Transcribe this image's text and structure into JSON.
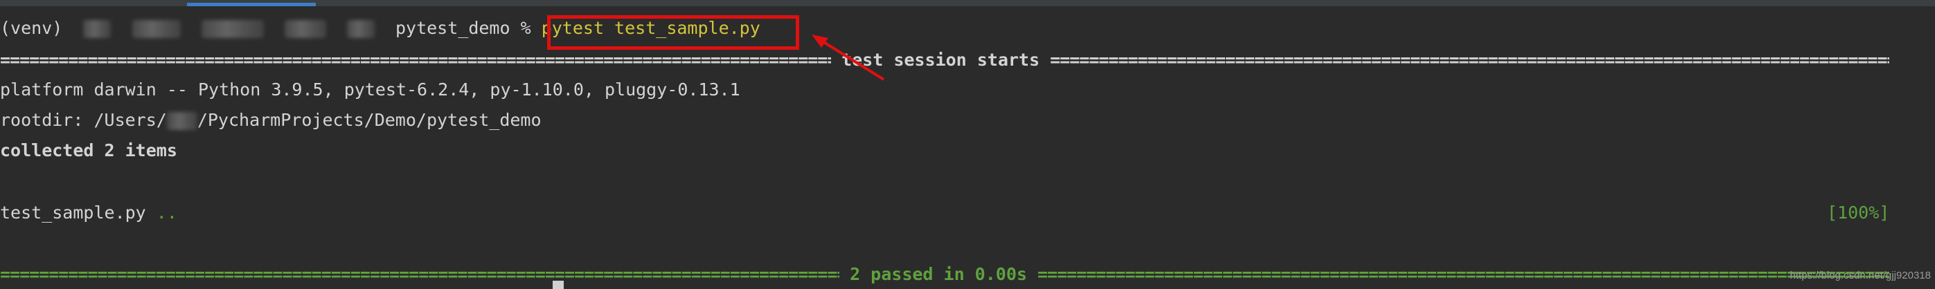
{
  "terminal": {
    "prompt_env": "(venv)",
    "prompt_dir": "pytest_demo %",
    "command": "pytest test_sample.py",
    "session_header": "test session starts",
    "platform_line": "platform darwin -- Python 3.9.5, pytest-6.2.4, py-1.10.0, pluggy-0.13.1",
    "rootdir_prefix": "rootdir: /Users/",
    "rootdir_suffix": "/PycharmProjects/Demo/pytest_demo",
    "collected_line": "collected 2 items",
    "test_file": "test_sample.py",
    "test_dots": "..",
    "progress": "[100%]",
    "summary": "2 passed in 0.00s"
  },
  "watermark": "https://blog.csdn.net/gjj920318",
  "colors": {
    "background": "#2b2b2b",
    "text": "#d4d4d4",
    "pass_green": "#5fa23e",
    "command_yellow": "#d6c53a",
    "highlight_red": "#e01010",
    "tab_blue": "#3d7ec9"
  }
}
